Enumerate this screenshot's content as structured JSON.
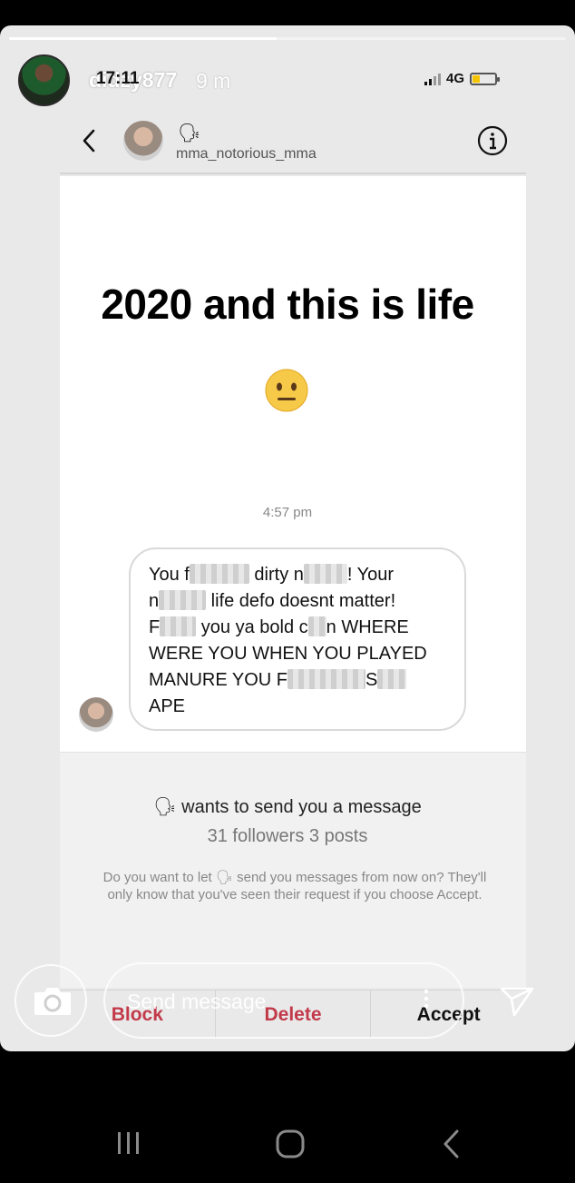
{
  "story": {
    "username": "didzy877",
    "age": "9 m",
    "progress": 0.48
  },
  "status_bar": {
    "time": "17:11",
    "network": "4G",
    "battery_level": 0.35,
    "battery_color": "#f5c400"
  },
  "dm": {
    "sender_emoji": "🗣",
    "username": "mma_notorious_mma"
  },
  "overlay": {
    "headline": "2020 and this is life",
    "emoji": "😐"
  },
  "message": {
    "time": "4:57 pm",
    "line1_a": "You f",
    "line1_b": " dirty n",
    "line1_c": "! Your",
    "line2_a": "n",
    "line2_b": " life defo doesnt matter!",
    "line3_a": "F",
    "line3_b": " you ya bold c",
    "line3_c": "n WHERE",
    "line4": "WERE YOU WHEN YOU PLAYED",
    "line5_a": "MANURE YOU F",
    "line5_b": "S",
    "line6": "APE"
  },
  "request": {
    "emoji": "🗣",
    "title": " wants to send you a message",
    "stats": "31 followers 3 posts",
    "desc_a": "Do you want to let ",
    "desc_emoji": "🗣",
    "desc_b": " send you messages from now on? They'll only know that you've seen their request if you choose Accept."
  },
  "actions": {
    "block": "Block",
    "delete": "Delete",
    "accept": "Accept"
  },
  "reply": {
    "placeholder": "Send message"
  },
  "colors": {
    "danger": "#c23a4a",
    "story_bg": "#e9e9e9"
  },
  "icons": [
    "back-icon",
    "info-icon",
    "camera-icon",
    "more-icon",
    "send-icon",
    "recent-apps-icon",
    "home-icon",
    "nav-back-icon"
  ]
}
